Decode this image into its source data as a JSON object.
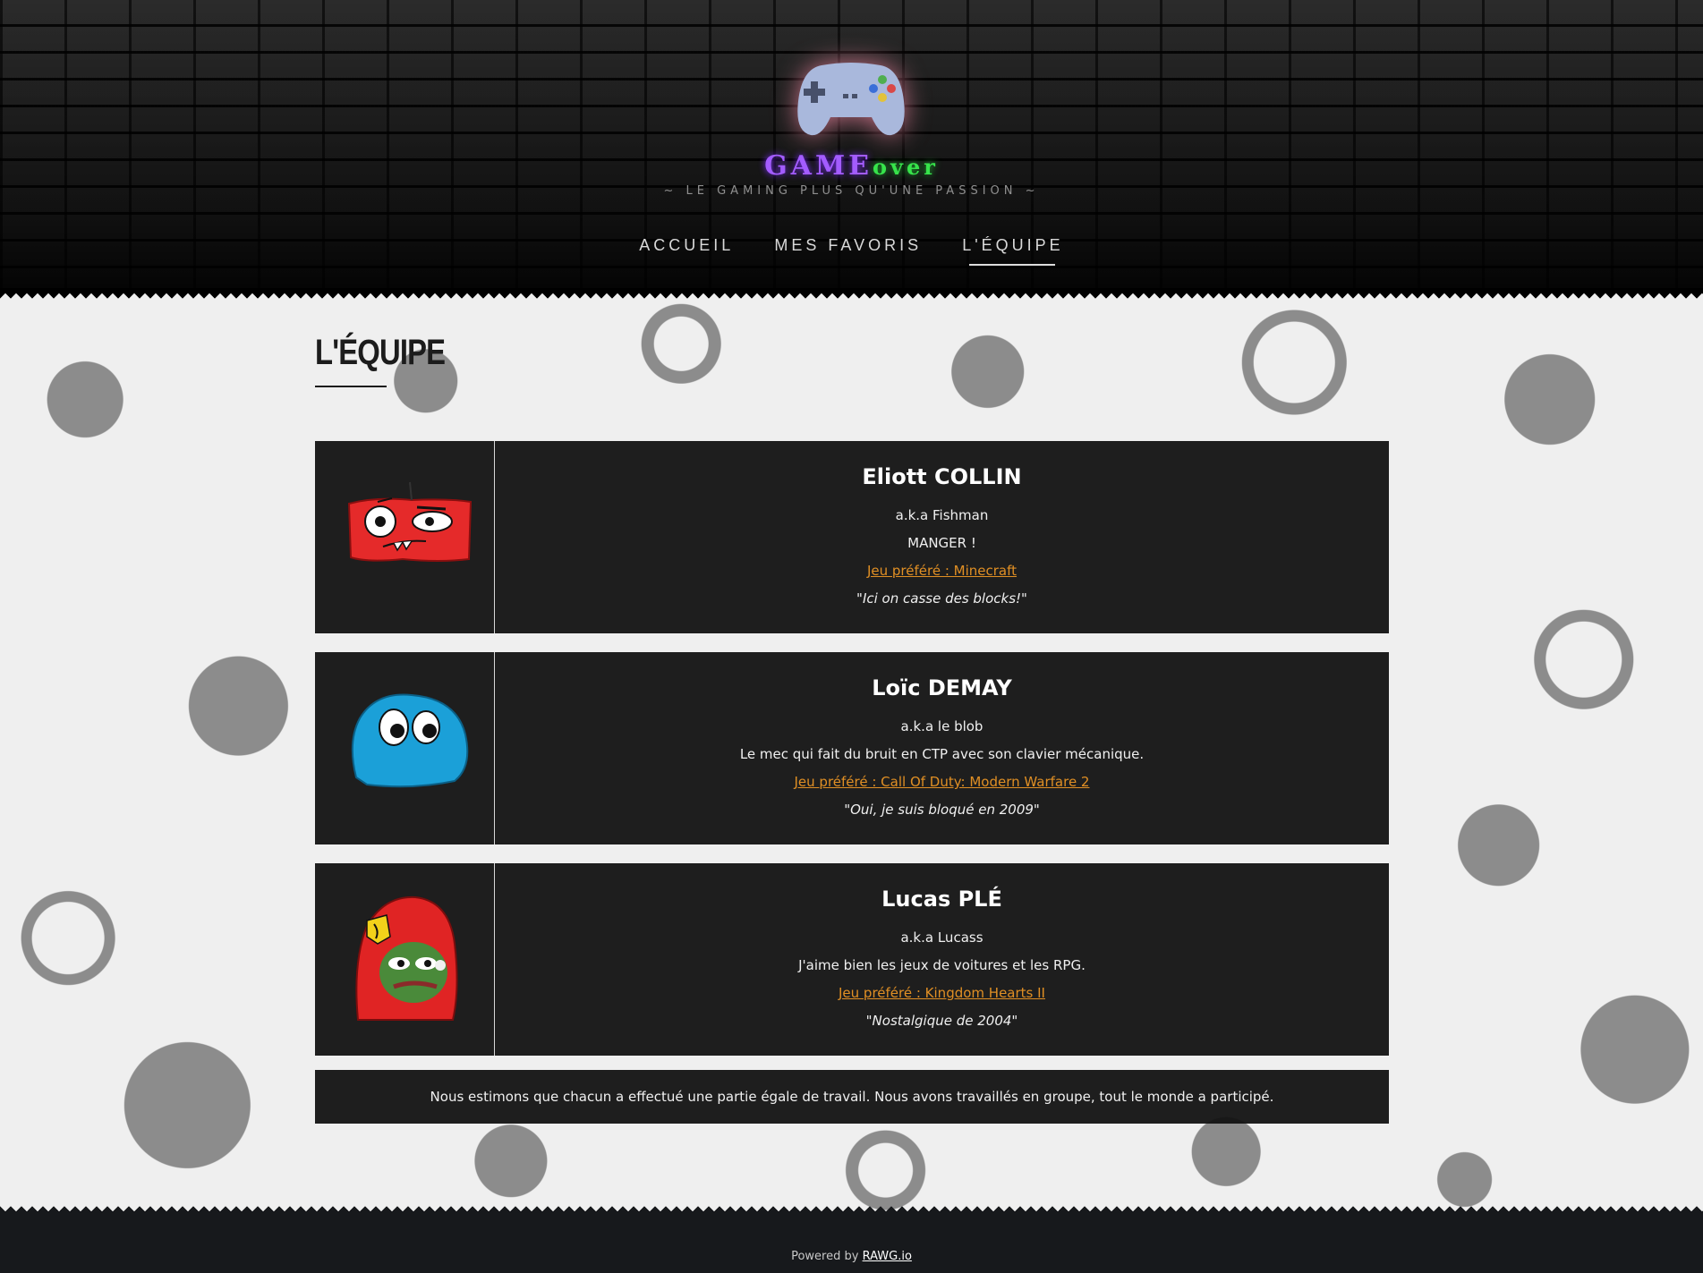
{
  "brand": {
    "game": "GAME",
    "over": "over",
    "tagline": "~ LE GAMING PLUS QU'UNE PASSION ~",
    "logo_icon": "gamepad-icon"
  },
  "nav": {
    "items": [
      {
        "label": "ACCUEIL",
        "active": false
      },
      {
        "label": "MES FAVORIS",
        "active": false
      },
      {
        "label": "L'ÉQUIPE",
        "active": true
      }
    ]
  },
  "page": {
    "title": "L'ÉQUIPE"
  },
  "members": [
    {
      "name": "Eliott COLLIN",
      "alias": "a.k.a Fishman",
      "description": "MANGER !",
      "favorite": "Jeu préféré : Minecraft",
      "quote": "\"Ici on casse des blocks!\"",
      "avatar": "red-face-avatar"
    },
    {
      "name": "Loïc DEMAY",
      "alias": "a.k.a le blob",
      "description": "Le mec qui fait du bruit en CTP avec son clavier mécanique.",
      "favorite": "Jeu préféré : Call Of Duty: Modern Warfare 2",
      "quote": "\"Oui, je suis bloqué en 2009\"",
      "avatar": "blue-blob-avatar"
    },
    {
      "name": "Lucas PLÉ",
      "alias": "a.k.a Lucass",
      "description": "J'aime bien les jeux de voitures et les RPG.",
      "favorite": "Jeu préféré : Kingdom Hearts II",
      "quote": "\"Nostalgique de 2004\"",
      "avatar": "frog-hoodie-avatar"
    }
  ],
  "note": "Nous estimons que chacun a effectué une partie égale de travail. Nous avons travaillés en groupe, tout le monde a participé.",
  "footer": {
    "prefix": "Powered by ",
    "link": "RAWG.io"
  },
  "colors": {
    "accent_link": "#e08f24",
    "brand_game": "#a35cff",
    "brand_over": "#37e34b",
    "card_bg": "#121212"
  }
}
